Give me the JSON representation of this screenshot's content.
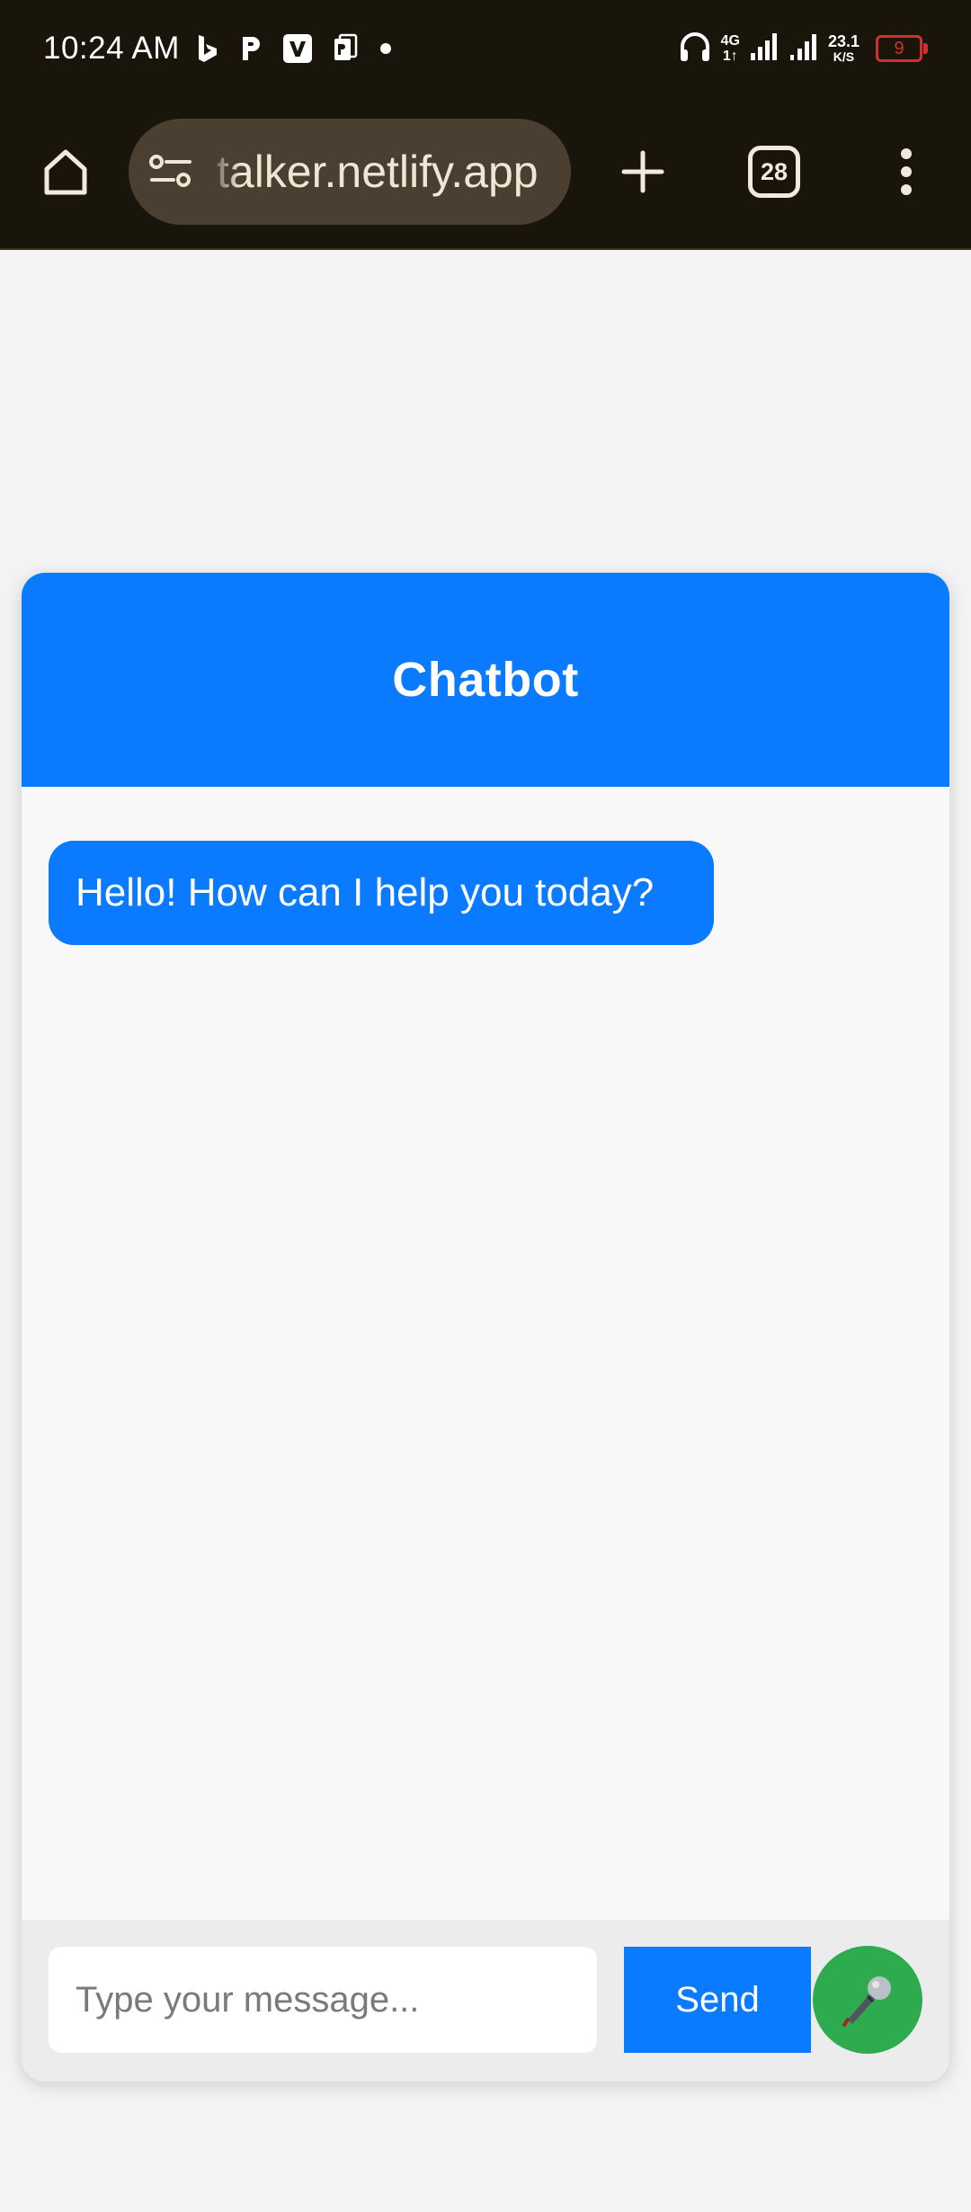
{
  "status_bar": {
    "time": "10:24 AM",
    "network_gen": "4G",
    "network_sub": "1↑",
    "speed_value": "23.1",
    "speed_unit": "K/S",
    "battery_level": "9",
    "notification_icons": [
      "bing-icon",
      "paytm-icon",
      "v-icon",
      "pdf-icon",
      "more-dot-icon"
    ]
  },
  "browser": {
    "url": "talker.netlify.app",
    "tab_count": "28"
  },
  "chat": {
    "title": "Chatbot",
    "messages": [
      {
        "sender": "bot",
        "text": "Hello! How can I help you today?"
      }
    ],
    "input_value": "",
    "input_placeholder": "Type your message...",
    "send_label": "Send",
    "mic_icon": "microphone-icon"
  },
  "colors": {
    "status_bar_bg": "#1a150b",
    "url_pill_bg": "#4a3f30",
    "primary": "#0a7bff",
    "mic_green": "#2eab4f",
    "battery_red": "#d32f2f",
    "page_bg": "#f3f3f3"
  }
}
